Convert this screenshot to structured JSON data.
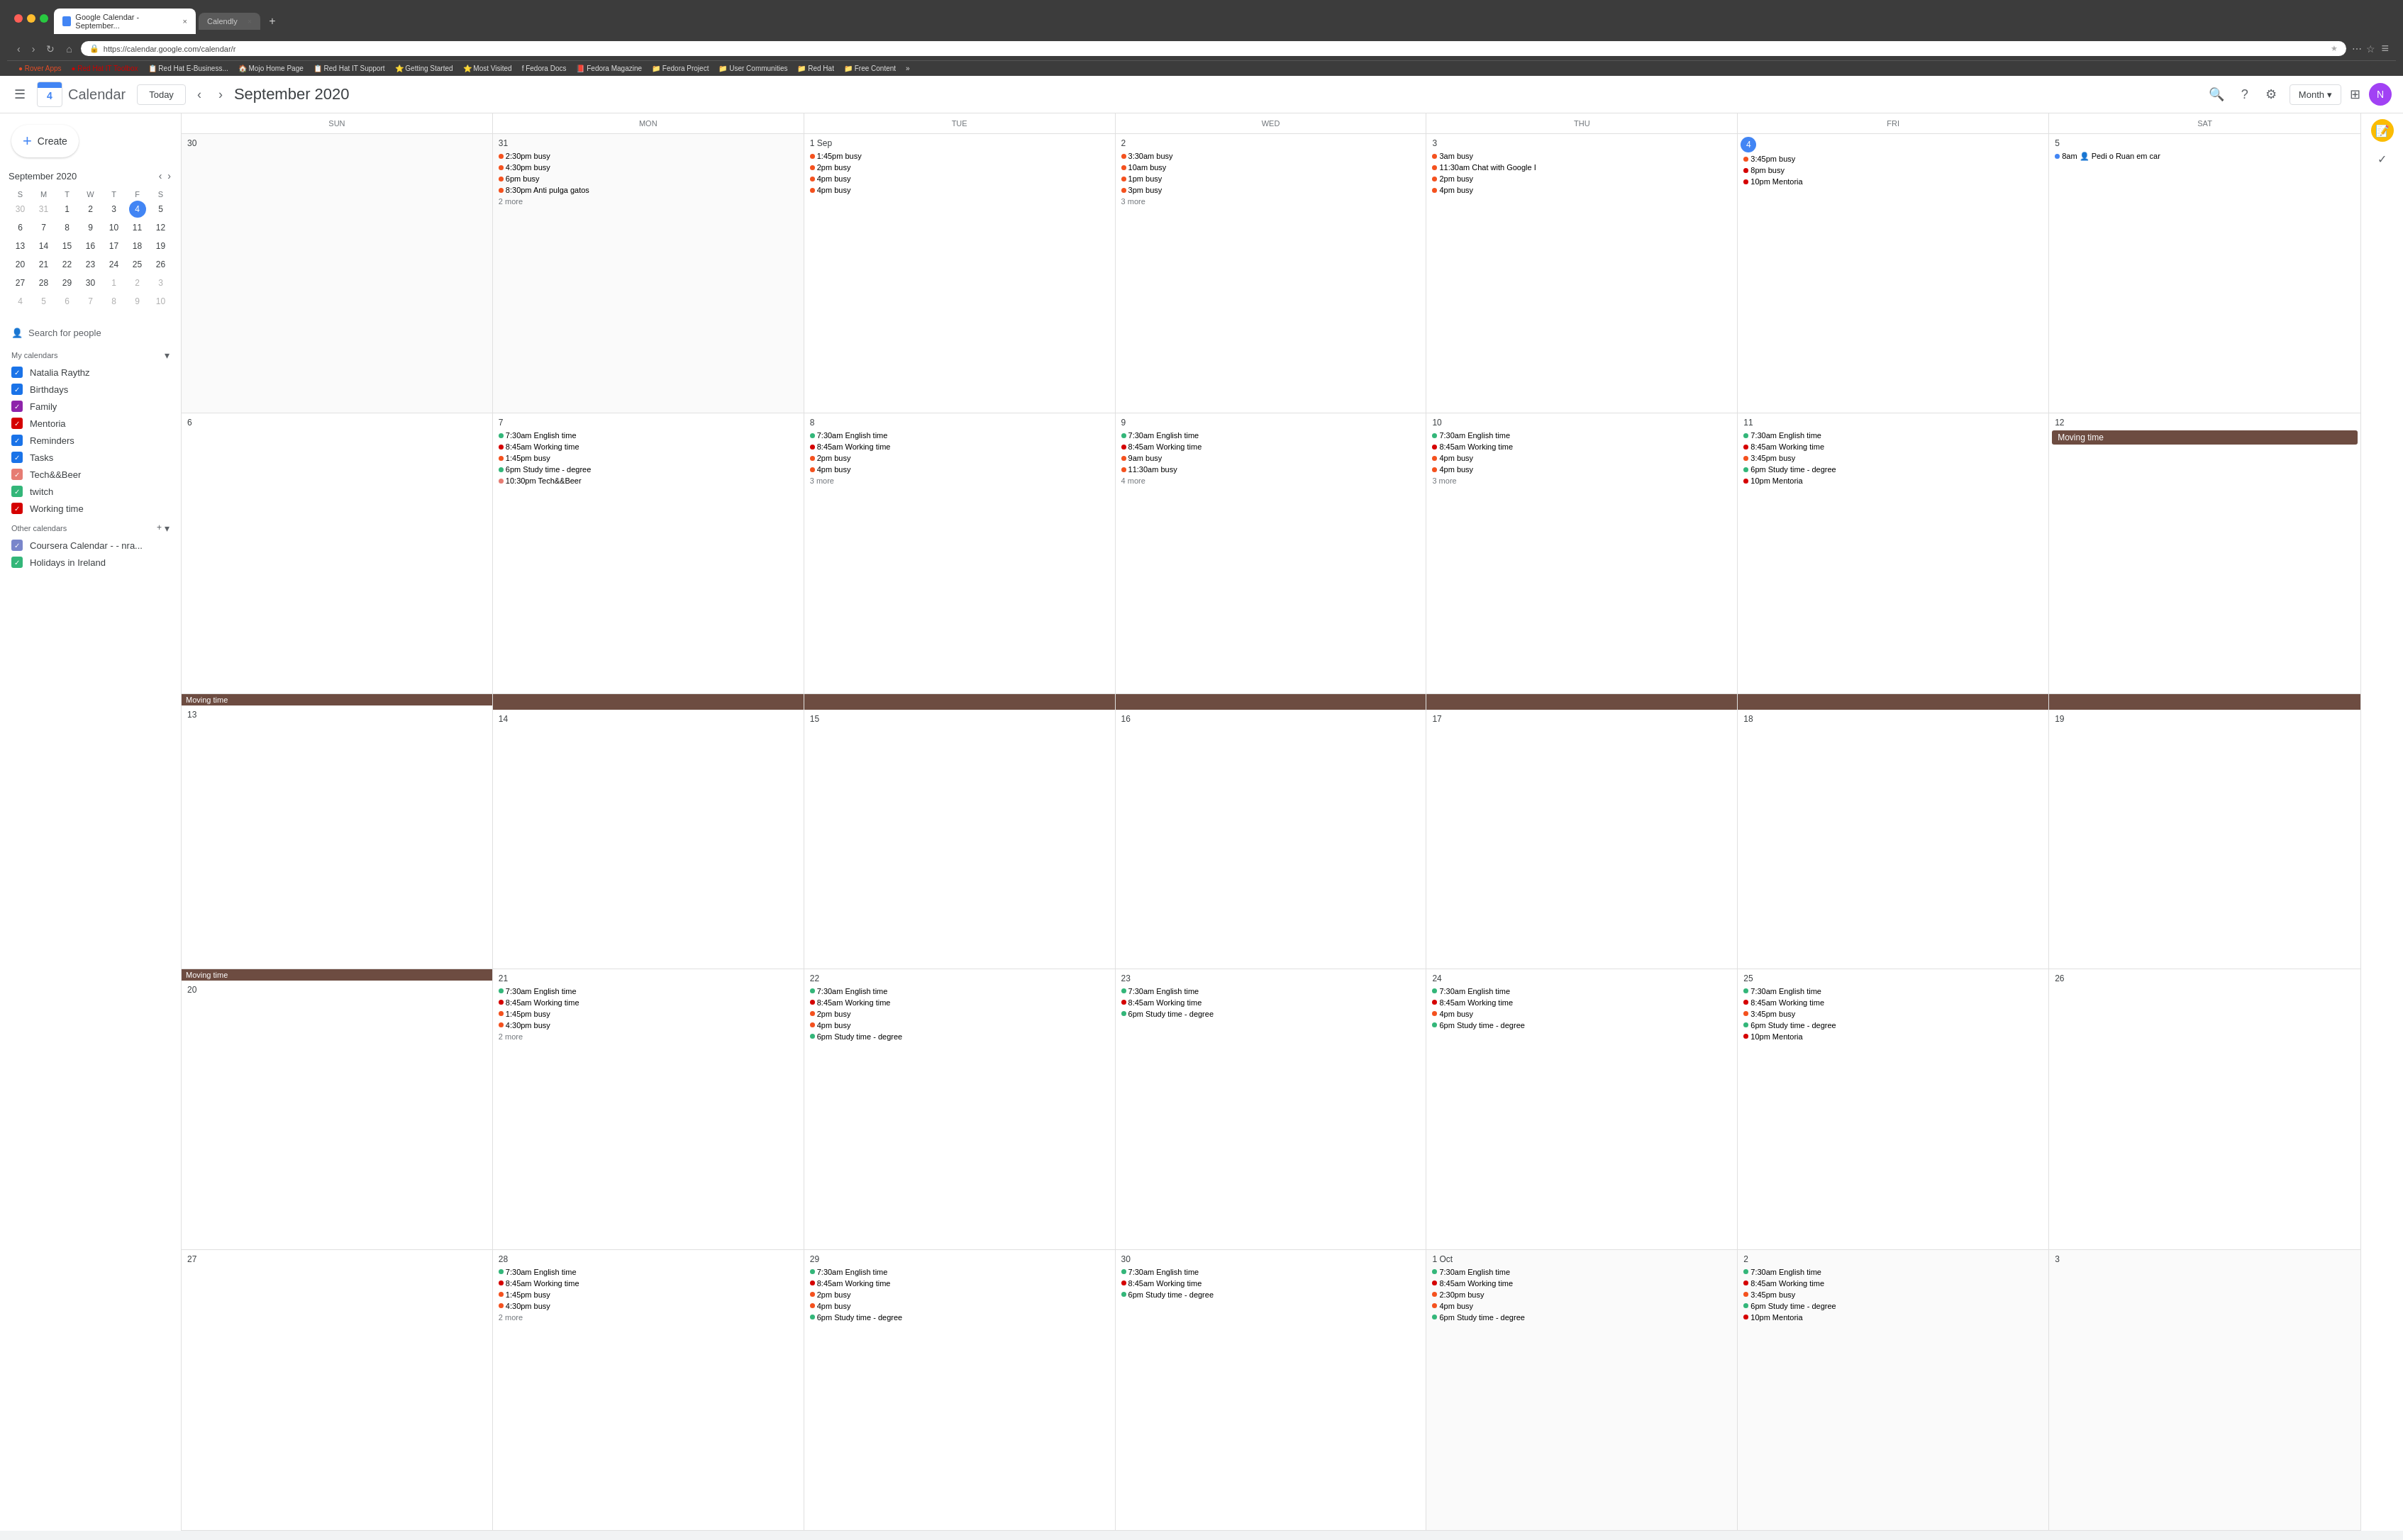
{
  "browser": {
    "tabs": [
      {
        "label": "Google Calendar - September...",
        "active": true
      },
      {
        "label": "Calendly",
        "active": false
      }
    ],
    "url": "https://calendar.google.com/calendar/r",
    "bookmarks": [
      "Rover Apps",
      "Red Hat IT Toolbox",
      "Red Hat E-Business...",
      "Mojo Home Page",
      "Red Hat IT Support",
      "Getting Started",
      "Most Visited",
      "Fedora Docs",
      "Fedora Magazine",
      "Fedora Project",
      "User Communities",
      "Red Hat",
      "Free Content"
    ]
  },
  "header": {
    "title": "Calendar",
    "month_year": "September 2020",
    "today_label": "Today",
    "view_label": "Month",
    "create_label": "Create"
  },
  "mini_calendar": {
    "title": "September 2020",
    "days_of_week": [
      "S",
      "M",
      "T",
      "W",
      "T",
      "F",
      "S"
    ],
    "weeks": [
      [
        {
          "day": "30",
          "other": true
        },
        {
          "day": "31",
          "other": true
        },
        {
          "day": "1"
        },
        {
          "day": "2"
        },
        {
          "day": "3"
        },
        {
          "day": "4",
          "today": true
        },
        {
          "day": "5"
        }
      ],
      [
        {
          "day": "6"
        },
        {
          "day": "7"
        },
        {
          "day": "8"
        },
        {
          "day": "9"
        },
        {
          "day": "10"
        },
        {
          "day": "11"
        },
        {
          "day": "12"
        }
      ],
      [
        {
          "day": "13"
        },
        {
          "day": "14"
        },
        {
          "day": "15"
        },
        {
          "day": "16"
        },
        {
          "day": "17"
        },
        {
          "day": "18"
        },
        {
          "day": "19"
        }
      ],
      [
        {
          "day": "20"
        },
        {
          "day": "21"
        },
        {
          "day": "22"
        },
        {
          "day": "23"
        },
        {
          "day": "24"
        },
        {
          "day": "25"
        },
        {
          "day": "26"
        }
      ],
      [
        {
          "day": "27"
        },
        {
          "day": "28"
        },
        {
          "day": "29"
        },
        {
          "day": "30"
        },
        {
          "day": "1",
          "other": true
        },
        {
          "day": "2",
          "other": true
        },
        {
          "day": "3",
          "other": true
        }
      ],
      [
        {
          "day": "4",
          "other": true
        },
        {
          "day": "5",
          "other": true
        },
        {
          "day": "6",
          "other": true
        },
        {
          "day": "7",
          "other": true
        },
        {
          "day": "8",
          "other": true
        },
        {
          "day": "9",
          "other": true
        },
        {
          "day": "10",
          "other": true
        }
      ]
    ]
  },
  "sidebar": {
    "search_people": "Search for people",
    "my_calendars_label": "My calendars",
    "my_calendars": [
      {
        "name": "Natalia Raythz",
        "color": "#1a73e8",
        "checked": true
      },
      {
        "name": "Birthdays",
        "color": "#1a73e8",
        "checked": true
      },
      {
        "name": "Family",
        "color": "#8e24aa",
        "checked": true
      },
      {
        "name": "Mentoria",
        "color": "#d50000",
        "checked": true
      },
      {
        "name": "Reminders",
        "color": "#1a73e8",
        "checked": true
      },
      {
        "name": "Tasks",
        "color": "#1a73e8",
        "checked": true
      },
      {
        "name": "Tech&&Beer",
        "color": "#e67c73",
        "checked": true
      },
      {
        "name": "twitch",
        "color": "#33b679",
        "checked": true
      },
      {
        "name": "Working time",
        "color": "#d50000",
        "checked": true
      }
    ],
    "other_calendars_label": "Other calendars",
    "other_calendars": [
      {
        "name": "Coursera Calendar - - nra...",
        "color": "#7986cb",
        "checked": true
      },
      {
        "name": "Holidays in Ireland",
        "color": "#33b679",
        "checked": true
      }
    ]
  },
  "calendar": {
    "days_of_week": [
      "SUN",
      "MON",
      "TUE",
      "WED",
      "THU",
      "FRI",
      "SAT"
    ],
    "weeks": [
      {
        "cells": [
          {
            "day": "30",
            "other": true,
            "events": []
          },
          {
            "day": "31",
            "other": true,
            "events": [
              {
                "time": "2:30pm",
                "label": "busy",
                "dot": "#f4511e"
              },
              {
                "time": "4:30pm",
                "label": "busy",
                "dot": "#f4511e"
              },
              {
                "time": "6pm",
                "label": "busy",
                "dot": "#f4511e"
              },
              {
                "time": "8:30pm",
                "label": "Anti pulga gatos",
                "dot": "#f4511e"
              }
            ],
            "more": "2 more"
          },
          {
            "day": "1 Sep",
            "events": [
              {
                "time": "1:45pm",
                "label": "busy",
                "dot": "#f4511e"
              },
              {
                "time": "2pm",
                "label": "busy",
                "dot": "#f4511e"
              },
              {
                "time": "4pm",
                "label": "busy",
                "dot": "#f4511e"
              },
              {
                "time": "4pm",
                "label": "busy",
                "dot": "#f4511e"
              }
            ]
          },
          {
            "day": "2",
            "events": [
              {
                "time": "3:30am",
                "label": "busy",
                "dot": "#f4511e"
              },
              {
                "time": "10am",
                "label": "busy",
                "dot": "#f4511e"
              },
              {
                "time": "1pm",
                "label": "busy",
                "dot": "#f4511e"
              },
              {
                "time": "3pm",
                "label": "busy",
                "dot": "#f4511e"
              }
            ],
            "more": "3 more"
          },
          {
            "day": "3",
            "events": [
              {
                "time": "3am",
                "label": "busy",
                "dot": "#f4511e"
              },
              {
                "time": "11:30am",
                "label": "Chat with Google I",
                "dot": "#f4511e"
              },
              {
                "time": "2pm",
                "label": "busy",
                "dot": "#f4511e"
              },
              {
                "time": "4pm",
                "label": "busy",
                "dot": "#f4511e"
              }
            ]
          },
          {
            "day": "4",
            "today": true,
            "events": [
              {
                "time": "3:45pm",
                "label": "busy",
                "dot": "#f4511e"
              },
              {
                "time": "8pm",
                "label": "busy",
                "dot": "#d50000"
              },
              {
                "time": "10pm",
                "label": "Mentoria",
                "dot": "#d50000"
              }
            ]
          },
          {
            "day": "5",
            "events": [
              {
                "time": "8am",
                "label": "Pedi o Ruan em car",
                "dot": "#4285f4",
                "type": "dot-blue"
              }
            ]
          }
        ]
      },
      {
        "cells": [
          {
            "day": "6",
            "events": []
          },
          {
            "day": "7",
            "events": [
              {
                "time": "7:30am",
                "label": "English time",
                "dot": "#33b679"
              },
              {
                "time": "8:45am",
                "label": "Working time",
                "dot": "#d50000"
              },
              {
                "time": "1:45pm",
                "label": "busy",
                "dot": "#f4511e"
              },
              {
                "time": "6pm",
                "label": "Study time - degree",
                "dot": "#33b679"
              },
              {
                "time": "10:30pm",
                "label": "Tech&&Beer",
                "dot": "#e67c73"
              }
            ]
          },
          {
            "day": "8",
            "events": [
              {
                "time": "7:30am",
                "label": "English time",
                "dot": "#33b679"
              },
              {
                "time": "8:45am",
                "label": "Working time",
                "dot": "#d50000"
              },
              {
                "time": "2pm",
                "label": "busy",
                "dot": "#f4511e"
              },
              {
                "time": "4pm",
                "label": "busy",
                "dot": "#f4511e"
              }
            ],
            "more": "3 more"
          },
          {
            "day": "9",
            "events": [
              {
                "time": "7:30am",
                "label": "English time",
                "dot": "#33b679"
              },
              {
                "time": "8:45am",
                "label": "Working time",
                "dot": "#d50000"
              },
              {
                "time": "9am",
                "label": "busy",
                "dot": "#f4511e"
              },
              {
                "time": "11:30am",
                "label": "busy",
                "dot": "#f4511e"
              }
            ],
            "more": "4 more"
          },
          {
            "day": "10",
            "events": [
              {
                "time": "7:30am",
                "label": "English time",
                "dot": "#33b679"
              },
              {
                "time": "8:45am",
                "label": "Working time",
                "dot": "#d50000"
              },
              {
                "time": "4pm",
                "label": "busy",
                "dot": "#f4511e"
              },
              {
                "time": "4pm",
                "label": "busy",
                "dot": "#f4511e"
              }
            ],
            "more": "3 more"
          },
          {
            "day": "11",
            "events": [
              {
                "time": "7:30am",
                "label": "English time",
                "dot": "#33b679"
              },
              {
                "time": "8:45am",
                "label": "Working time",
                "dot": "#d50000"
              },
              {
                "time": "3:45pm",
                "label": "busy",
                "dot": "#f4511e"
              },
              {
                "time": "6pm",
                "label": "Study time - degree",
                "dot": "#33b679"
              },
              {
                "time": "10pm",
                "label": "Mentoria",
                "dot": "#d50000"
              }
            ]
          },
          {
            "day": "12",
            "moving_time": true,
            "events": []
          }
        ]
      },
      {
        "moving_time_row": true,
        "moving_time_label": "Moving time",
        "cells": [
          {
            "day": "13",
            "events": []
          },
          {
            "day": "14",
            "events": []
          },
          {
            "day": "15",
            "events": []
          },
          {
            "day": "16",
            "events": []
          },
          {
            "day": "17",
            "events": []
          },
          {
            "day": "18",
            "events": []
          },
          {
            "day": "19",
            "events": []
          }
        ]
      },
      {
        "cells": [
          {
            "day": "20",
            "moving_time_start": true,
            "events": []
          },
          {
            "day": "21",
            "events": [
              {
                "time": "7:30am",
                "label": "English time",
                "dot": "#33b679"
              },
              {
                "time": "8:45am",
                "label": "Working time",
                "dot": "#d50000"
              },
              {
                "time": "1:45pm",
                "label": "busy",
                "dot": "#f4511e"
              },
              {
                "time": "4:30pm",
                "label": "busy",
                "dot": "#f4511e"
              }
            ],
            "more": "2 more"
          },
          {
            "day": "22",
            "events": [
              {
                "time": "7:30am",
                "label": "English time",
                "dot": "#33b679"
              },
              {
                "time": "8:45am",
                "label": "Working time",
                "dot": "#d50000"
              },
              {
                "time": "2pm",
                "label": "busy",
                "dot": "#f4511e"
              },
              {
                "time": "4pm",
                "label": "busy",
                "dot": "#f4511e"
              },
              {
                "time": "6pm",
                "label": "Study time - degree",
                "dot": "#33b679"
              }
            ]
          },
          {
            "day": "23",
            "events": [
              {
                "time": "7:30am",
                "label": "English time",
                "dot": "#33b679"
              },
              {
                "time": "8:45am",
                "label": "Working time",
                "dot": "#d50000"
              },
              {
                "time": "6pm",
                "label": "Study time - degree",
                "dot": "#33b679"
              }
            ]
          },
          {
            "day": "24",
            "events": [
              {
                "time": "7:30am",
                "label": "English time",
                "dot": "#33b679"
              },
              {
                "time": "8:45am",
                "label": "Working time",
                "dot": "#d50000"
              },
              {
                "time": "4pm",
                "label": "busy",
                "dot": "#f4511e"
              },
              {
                "time": "6pm",
                "label": "Study time - degree",
                "dot": "#33b679"
              }
            ]
          },
          {
            "day": "25",
            "events": [
              {
                "time": "7:30am",
                "label": "English time",
                "dot": "#33b679"
              },
              {
                "time": "8:45am",
                "label": "Working time",
                "dot": "#d50000"
              },
              {
                "time": "3:45pm",
                "label": "busy",
                "dot": "#f4511e"
              },
              {
                "time": "6pm",
                "label": "Study time - degree",
                "dot": "#33b679"
              },
              {
                "time": "10pm",
                "label": "Mentoria",
                "dot": "#d50000"
              }
            ]
          },
          {
            "day": "26",
            "events": []
          }
        ]
      },
      {
        "cells": [
          {
            "day": "27",
            "events": []
          },
          {
            "day": "28",
            "events": [
              {
                "time": "7:30am",
                "label": "English time",
                "dot": "#33b679"
              },
              {
                "time": "8:45am",
                "label": "Working time",
                "dot": "#d50000"
              },
              {
                "time": "1:45pm",
                "label": "busy",
                "dot": "#f4511e"
              },
              {
                "time": "4:30pm",
                "label": "busy",
                "dot": "#f4511e"
              }
            ],
            "more": "2 more"
          },
          {
            "day": "29",
            "events": [
              {
                "time": "7:30am",
                "label": "English time",
                "dot": "#33b679"
              },
              {
                "time": "8:45am",
                "label": "Working time",
                "dot": "#d50000"
              },
              {
                "time": "2pm",
                "label": "busy",
                "dot": "#f4511e"
              },
              {
                "time": "4pm",
                "label": "busy",
                "dot": "#f4511e"
              },
              {
                "time": "6pm",
                "label": "Study time - degree",
                "dot": "#33b679"
              }
            ]
          },
          {
            "day": "30",
            "events": [
              {
                "time": "7:30am",
                "label": "English time",
                "dot": "#33b679"
              },
              {
                "time": "8:45am",
                "label": "Working time",
                "dot": "#d50000"
              },
              {
                "time": "6pm",
                "label": "Study time - degree",
                "dot": "#33b679"
              }
            ]
          },
          {
            "day": "1 Oct",
            "other": true,
            "events": [
              {
                "time": "7:30am",
                "label": "English time",
                "dot": "#33b679"
              },
              {
                "time": "8:45am",
                "label": "Working time",
                "dot": "#d50000"
              },
              {
                "time": "2:30pm",
                "label": "busy",
                "dot": "#f4511e"
              },
              {
                "time": "4pm",
                "label": "busy",
                "dot": "#f4511e"
              },
              {
                "time": "6pm",
                "label": "Study time - degree",
                "dot": "#33b679"
              }
            ]
          },
          {
            "day": "2",
            "other": true,
            "events": [
              {
                "time": "7:30am",
                "label": "English time",
                "dot": "#33b679"
              },
              {
                "time": "8:45am",
                "label": "Working time",
                "dot": "#d50000"
              },
              {
                "time": "3:45pm",
                "label": "busy",
                "dot": "#f4511e"
              },
              {
                "time": "6pm",
                "label": "Study time - degree",
                "dot": "#33b679"
              },
              {
                "time": "10pm",
                "label": "Mentoria",
                "dot": "#d50000"
              }
            ]
          },
          {
            "day": "3",
            "other": true,
            "events": []
          }
        ]
      }
    ]
  }
}
